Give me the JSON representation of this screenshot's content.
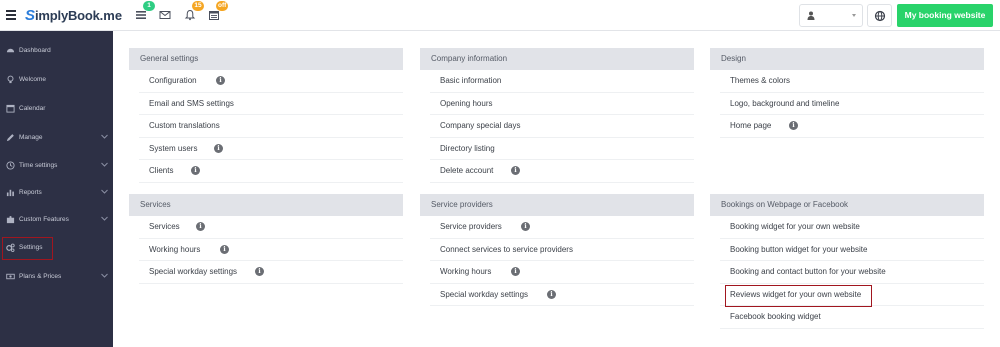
{
  "topbar": {
    "logo": {
      "prefix": "S",
      "name": "implyBook",
      "suffix": ".me"
    },
    "badges": {
      "tasks": "1",
      "notifications": "15",
      "calendar": "off"
    },
    "cta_label": "My booking website"
  },
  "sidebar": {
    "items": [
      {
        "label": "Dashboard",
        "icon": "dashboard-icon",
        "has_submenu": false
      },
      {
        "label": "Welcome",
        "icon": "lightbulb-icon",
        "has_submenu": false
      },
      {
        "label": "Calendar",
        "icon": "calendar-icon",
        "has_submenu": false
      },
      {
        "label": "Manage",
        "icon": "pencil-icon",
        "has_submenu": true
      },
      {
        "label": "Time settings",
        "icon": "clock-icon",
        "has_submenu": true
      },
      {
        "label": "Reports",
        "icon": "bar-chart-icon",
        "has_submenu": true
      },
      {
        "label": "Custom Features",
        "icon": "puzzle-icon",
        "has_submenu": true
      },
      {
        "label": "Settings",
        "icon": "gears-icon",
        "has_submenu": false,
        "active": true
      },
      {
        "label": "Plans & Prices",
        "icon": "money-icon",
        "has_submenu": true
      }
    ]
  },
  "panels": {
    "general": {
      "title": "General settings",
      "items": [
        "Configuration",
        "Email and SMS settings",
        "Custom translations",
        "System users",
        "Clients"
      ]
    },
    "company": {
      "title": "Company information",
      "items": [
        "Basic information",
        "Opening hours",
        "Company special days",
        "Directory listing",
        "Delete account"
      ]
    },
    "design": {
      "title": "Design",
      "items": [
        "Themes & colors",
        "Logo, background and timeline",
        "Home page"
      ]
    },
    "services": {
      "title": "Services",
      "items": [
        "Services",
        "Working hours",
        "Special workday settings"
      ]
    },
    "providers": {
      "title": "Service providers",
      "items": [
        "Service providers",
        "Connect services to service providers",
        "Working hours",
        "Special workday settings"
      ]
    },
    "bookings": {
      "title": "Bookings on Webpage or Facebook",
      "items": [
        "Booking widget for your own website",
        "Booking button widget for your website",
        "Booking and contact button for your website",
        "Reviews widget for your own website",
        "Facebook booking widget"
      ]
    }
  },
  "info_glyph": "i",
  "colors": {
    "sidebar_bg": "#2d3045",
    "cta": "#29d36a",
    "accent": "#2b7ddb",
    "highlight": "#a1161f"
  }
}
